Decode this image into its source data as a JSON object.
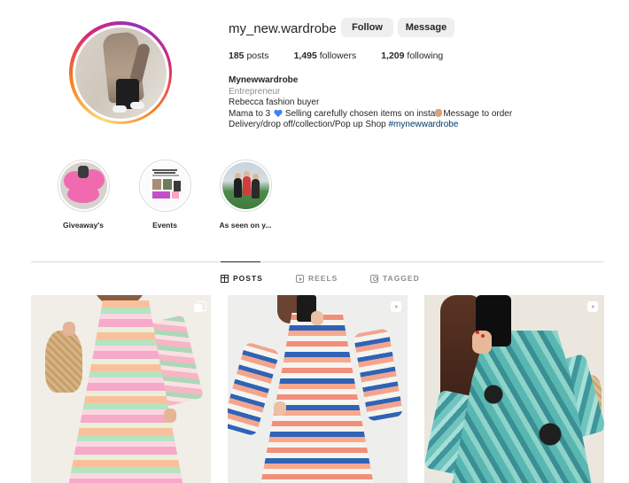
{
  "profile": {
    "username": "my_new.wardrobe",
    "follow_label": "Follow",
    "message_label": "Message",
    "stats": {
      "posts_count": "185",
      "posts_label": "posts",
      "followers_count": "1,495",
      "followers_label": "followers",
      "following_count": "1,209",
      "following_label": "following"
    },
    "bio": {
      "name": "Mynewwardrobe",
      "category": "Entrepreneur",
      "line1": "Rebecca fashion buyer",
      "line2_a": "Mama to 3",
      "line2_b": "Selling carefully chosen items on insta",
      "line2_c": "Message to order",
      "line3": "Delivery/drop off/collection/Pop up Shop",
      "hashtag": "#mynewwardrobe"
    }
  },
  "highlights": [
    {
      "label": "Giveaway's"
    },
    {
      "label": "Events"
    },
    {
      "label": "As seen on y..."
    }
  ],
  "tabs": {
    "posts": "POSTS",
    "reels": "REELS",
    "tagged": "TAGGED"
  },
  "colors": {
    "accent_link": "#00376b",
    "text_primary": "#262626",
    "text_secondary": "#8e8e8e",
    "button_bg": "#efefef"
  }
}
